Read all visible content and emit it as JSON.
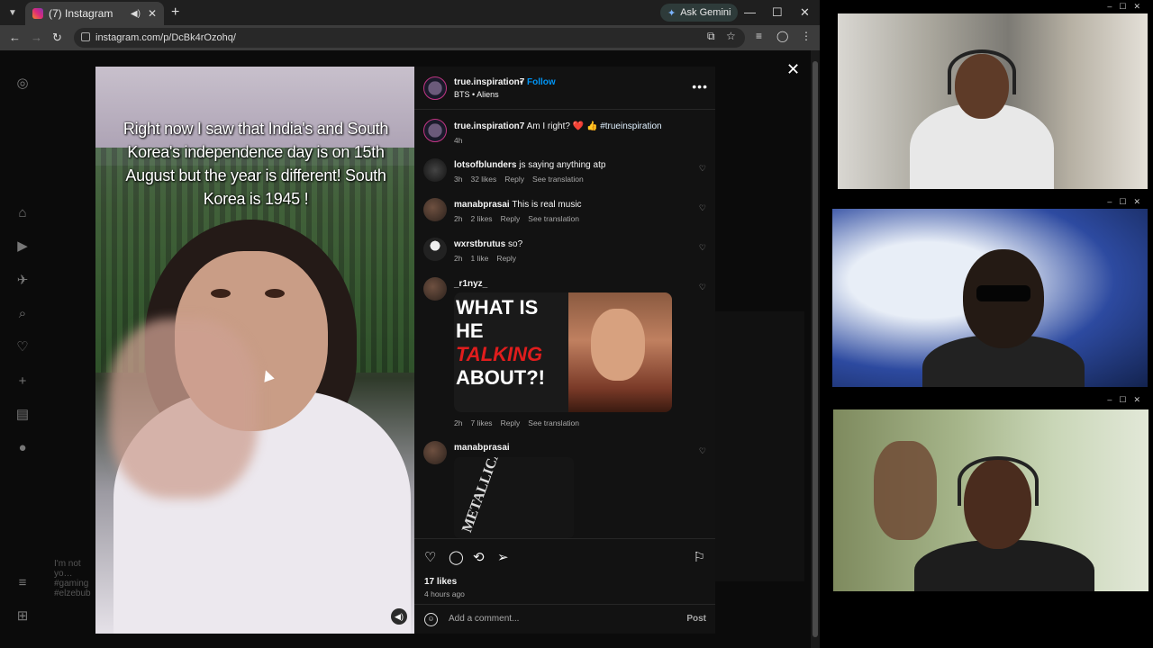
{
  "browser": {
    "tab_title": "(7) Instagram",
    "url": "instagram.com/p/DcBk4rOzohq/",
    "gemini_label": "Ask Gemini",
    "new_tab": "+",
    "tab_close": "✕",
    "minimize": "—",
    "maximize": "☐",
    "close": "✕"
  },
  "post": {
    "author": "true.inspiration7",
    "follow_label": "Follow",
    "audio": "BTS • Aliens",
    "caption_overlay": "Right now I saw that India's and South Korea's independence day is on 15th August but the year is different! South Korea is 1945 !",
    "caption_user": "true.inspiration7",
    "caption_text": "Am I right? ❤️ 👍",
    "caption_hashtag": "#trueinspiration",
    "caption_time": "4h",
    "likes": "17 likes",
    "posted_ago": "4 hours ago",
    "add_comment_placeholder": "Add a comment...",
    "post_label": "Post"
  },
  "comments": [
    {
      "user": "lotsofblunders",
      "text": "js saying anything atp",
      "time": "3h",
      "likes": "32 likes",
      "reply": "Reply",
      "translate": "See translation"
    },
    {
      "user": "manabprasai",
      "text": "This is real music",
      "time": "2h",
      "likes": "2 likes",
      "reply": "Reply",
      "translate": "See translation"
    },
    {
      "user": "wxrstbrutus",
      "text": "so?",
      "time": "2h",
      "likes": "1 like",
      "reply": "Reply",
      "translate": ""
    },
    {
      "user": "_r1nyz_",
      "text": "",
      "time": "2h",
      "likes": "7 likes",
      "reply": "Reply",
      "translate": "See translation"
    },
    {
      "user": "manabprasai",
      "text": "",
      "time": "",
      "likes": "",
      "reply": "",
      "translate": ""
    }
  ],
  "gif": {
    "line1": "WHAT IS",
    "line2": "HE",
    "line3": "TALKING",
    "line4": "ABOUT?!"
  },
  "album_logo": "METALLICA",
  "bg_feed_text": "I'm not yo… #gaming #elzebub",
  "icons": {
    "like": "heart-icon",
    "comment": "comment-icon",
    "repost": "repost-icon",
    "share": "share-icon",
    "save": "bookmark-icon"
  },
  "colors": {
    "follow": "#0095f6",
    "background": "#121212",
    "modal": "#000000"
  }
}
